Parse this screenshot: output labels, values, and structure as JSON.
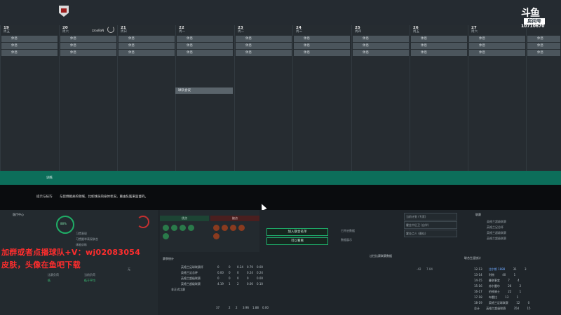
{
  "calendar": {
    "days": [
      {
        "num": "19",
        "name": "周五",
        "slots": [
          "休息",
          "休息",
          "休息"
        ]
      },
      {
        "num": "20",
        "name": "周六",
        "slots": [
          "休息",
          "休息",
          "休息"
        ],
        "sub": "zzoaBaN"
      },
      {
        "num": "21",
        "name": "周日",
        "slots": [
          "休息",
          "休息",
          "休息"
        ]
      },
      {
        "num": "22",
        "name": "周一",
        "slots": [
          "休息",
          "休息",
          "休息"
        ]
      },
      {
        "num": "23",
        "name": "周二",
        "slots": [
          "休息",
          "休息",
          "休息"
        ]
      },
      {
        "num": "24",
        "name": "周三",
        "slots": [
          "休息",
          "休息",
          "休息"
        ]
      },
      {
        "num": "25",
        "name": "周四",
        "slots": [
          "休息",
          "休息",
          "休息"
        ]
      },
      {
        "num": "26",
        "name": "周五",
        "slots": [
          "休息",
          "休息",
          "休息"
        ]
      },
      {
        "num": "27",
        "name": "周六",
        "slots": [
          "休息",
          "休息",
          "休息"
        ]
      },
      {
        "num": "",
        "name": "",
        "slots": [
          "休息",
          "休息",
          "休息"
        ]
      }
    ],
    "popup_label": "球队会议"
  },
  "strip": {
    "label": "训练"
  },
  "tip": {
    "label": "提示与技巧",
    "text": "与您俱相关的领域，比如球员的身体状况，重由队医来监督的。"
  },
  "bottom": {
    "left_title": "医疗中心",
    "gauge_value": "88%",
    "left_line1": "习惯表现",
    "left_line2": "习惯跟举表现联合",
    "left_line3": "体能训练",
    "left_footer_a": "比赛负荷",
    "left_footer_b": "当前负荷",
    "left_value_a": "低",
    "left_value_b": "低于平均",
    "small_c": "无",
    "advantages_title": "优点",
    "weaknesses_title": "缺点",
    "btn_join": "加入联合名单",
    "btn_view": "可以看看",
    "status_a": "已开启数据",
    "status_b": "数据展示",
    "dropdown1": "当前计划 (专家)",
    "dropdown2": "霍金中后卫 (自学)",
    "dropdown3": "霍金点人 (最佳)",
    "table_title": "赛季统计",
    "table_rows": [
      {
        "name": "英格兰足球联赛杯",
        "vals": [
          "0",
          "0",
          "0.24",
          "0.79",
          "0.00"
        ]
      },
      {
        "name": "英格兰足总杯",
        "vals": [
          "0.00",
          "0",
          "0",
          "0.24",
          "0.24"
        ]
      },
      {
        "name": "英格兰超级联赛",
        "vals": [
          "0",
          "0",
          "0",
          "0",
          "0.00"
        ]
      },
      {
        "name": "英格兰超级联赛",
        "vals": [
          "4.19",
          "1",
          "2",
          "0.00",
          "0.10"
        ]
      },
      {
        "name": "非正式比赛",
        "vals": [
          "",
          "",
          "",
          "",
          ""
        ]
      }
    ],
    "table_total": [
      "37",
      "2",
      "2",
      "3.96",
      "1.88",
      "0.00"
    ],
    "mid_title": "过往比赛联赛数据",
    "mid_value": "-42",
    "mid_value2": "7.04",
    "right_title": "联赛",
    "right_items": [
      "英格兰超级联赛",
      "英格兰足总杯",
      "英格兰超级联赛",
      "英格兰超级联赛"
    ],
    "right_list_title": "联合生涯统计",
    "right_list": [
      {
        "a": "12-13",
        "b": "比尔斯 1888",
        "c": "31",
        "d": "3"
      },
      {
        "a": "13-14",
        "b": "利物",
        "c": "40",
        "d": "1"
      },
      {
        "a": "14-15",
        "b": "曼联事宜",
        "c": "7",
        "d": "4"
      },
      {
        "a": "15-16",
        "b": "苏尔曼尔",
        "c": "26",
        "d": "2"
      },
      {
        "a": "16-17",
        "b": "伯顿骑士",
        "c": "22",
        "d": "1"
      },
      {
        "a": "17-18",
        "b": "布雷比",
        "c": "13",
        "d": "1"
      },
      {
        "a": "18-19",
        "b": "英格兰足球联赛",
        "c": "12",
        "d": "0"
      },
      {
        "a": "总计",
        "b": "英格兰超级联赛",
        "c": "354",
        "d": "15"
      }
    ]
  },
  "overlay": {
    "line1": "加群或者点播球队+V：wj02083054",
    "line2": "皮肤，头像在鱼吧下载"
  },
  "watermark": {
    "brand": "斗鱼",
    "box": "房间号",
    "room": "10710670"
  }
}
